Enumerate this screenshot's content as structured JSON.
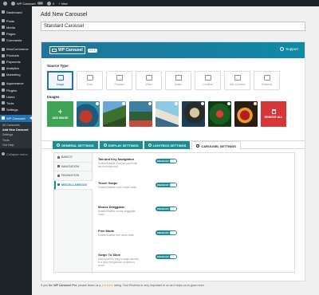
{
  "admin_bar": {
    "site_name": "WP Carousel",
    "badge": "Live",
    "comments_count": "0",
    "new_label": "+ New"
  },
  "sidebar": {
    "items": [
      {
        "label": "Dashboard",
        "icon": "dashboard-icon"
      },
      {
        "label": "Posts",
        "icon": "pin-icon"
      },
      {
        "label": "Media",
        "icon": "media-icon"
      },
      {
        "label": "Pages",
        "icon": "page-icon"
      },
      {
        "label": "Comments",
        "icon": "comment-icon"
      },
      {
        "label": "WooCommerce",
        "icon": "woo-icon"
      },
      {
        "label": "Products",
        "icon": "archive-icon"
      },
      {
        "label": "Payments",
        "icon": "card-icon"
      },
      {
        "label": "Analytics",
        "icon": "chart-icon"
      },
      {
        "label": "Marketing",
        "icon": "megaphone-icon"
      },
      {
        "label": "Appearance",
        "icon": "brush-icon"
      },
      {
        "label": "Plugins",
        "icon": "plug-icon"
      },
      {
        "label": "Users",
        "icon": "user-icon"
      },
      {
        "label": "Tools",
        "icon": "wrench-icon"
      },
      {
        "label": "Settings",
        "icon": "sliders-icon"
      },
      {
        "label": "WP Carousel",
        "icon": "carousel-icon"
      }
    ],
    "submenu": [
      "All Carousels",
      "Add New Carousel",
      "Settings",
      "Tools",
      "Get Help"
    ],
    "collapse_label": "Collapse menu"
  },
  "page": {
    "title": "Add New Carousel",
    "carousel_title": "Standard Carousel"
  },
  "wpcp": {
    "logo_text": "WP Carousel",
    "version": "4.1.2",
    "support_label": "Support",
    "source_type_label": "Source Type",
    "source_types": [
      {
        "label": "Image",
        "icon": "image-icon"
      },
      {
        "label": "Post",
        "icon": "pin-icon"
      },
      {
        "label": "Product",
        "icon": "product-icon"
      },
      {
        "label": "Video",
        "icon": "video-icon"
      },
      {
        "label": "Audio",
        "icon": "audio-icon"
      },
      {
        "label": "Content",
        "icon": "content-icon"
      },
      {
        "label": "Mix-Content",
        "icon": "mix-content-icon"
      },
      {
        "label": "External",
        "icon": "external-icon"
      }
    ],
    "images_label": "Images",
    "add_image_label": "ADD IMAGE",
    "remove_all_label": "REMOVE ALL",
    "tabs": [
      {
        "label": "GENERAL SETTINGS",
        "icon": "gear-icon"
      },
      {
        "label": "DISPLAY SETTINGS",
        "icon": "display-icon"
      },
      {
        "label": "LIGHTBOX SETTINGS",
        "icon": "lightbox-icon"
      },
      {
        "label": "CAROUSEL SETTINGS",
        "icon": "carousel-settings-icon"
      }
    ],
    "side_nav": [
      "BASICS",
      "NAVIGATION",
      "PAGINATION",
      "MISCELLANEOUS"
    ],
    "options": [
      {
        "title": "Tab and Key Navigation",
        "desc": "Enable/Disable carousel scroll with tab and keyboard.",
        "toggle": "ENABLED"
      },
      {
        "title": "Touch Swipe",
        "desc": "Enable/Disable touch swipe mode.",
        "toggle": "ENABLED"
      },
      {
        "title": "Mouse Draggable",
        "desc": "Enable/Disable mouse draggable mode.",
        "toggle": "ENABLED"
      },
      {
        "title": "Free Mode",
        "desc": "Enable/Disable free mode slider.",
        "toggle": "ENABLED"
      },
      {
        "title": "Swipe To Slide",
        "desc": "Allow users to drag or swipe directly to a slide irrespective of slides to scroll.",
        "toggle": "ENABLED"
      }
    ],
    "footer_pre": "If you like",
    "footer_brand": "WP Carousel Pro",
    "footer_mid": ", please leave us a",
    "footer_stars": "★★★★★",
    "footer_post": "rating. Your Reviews is very important to us as it helps us to grow more."
  },
  "colors": {
    "accent": "#1a8e93",
    "admin_dark": "#1d2327",
    "wp_blue": "#2271b1",
    "add_green": "#3ea455",
    "remove_red": "#d63638"
  }
}
